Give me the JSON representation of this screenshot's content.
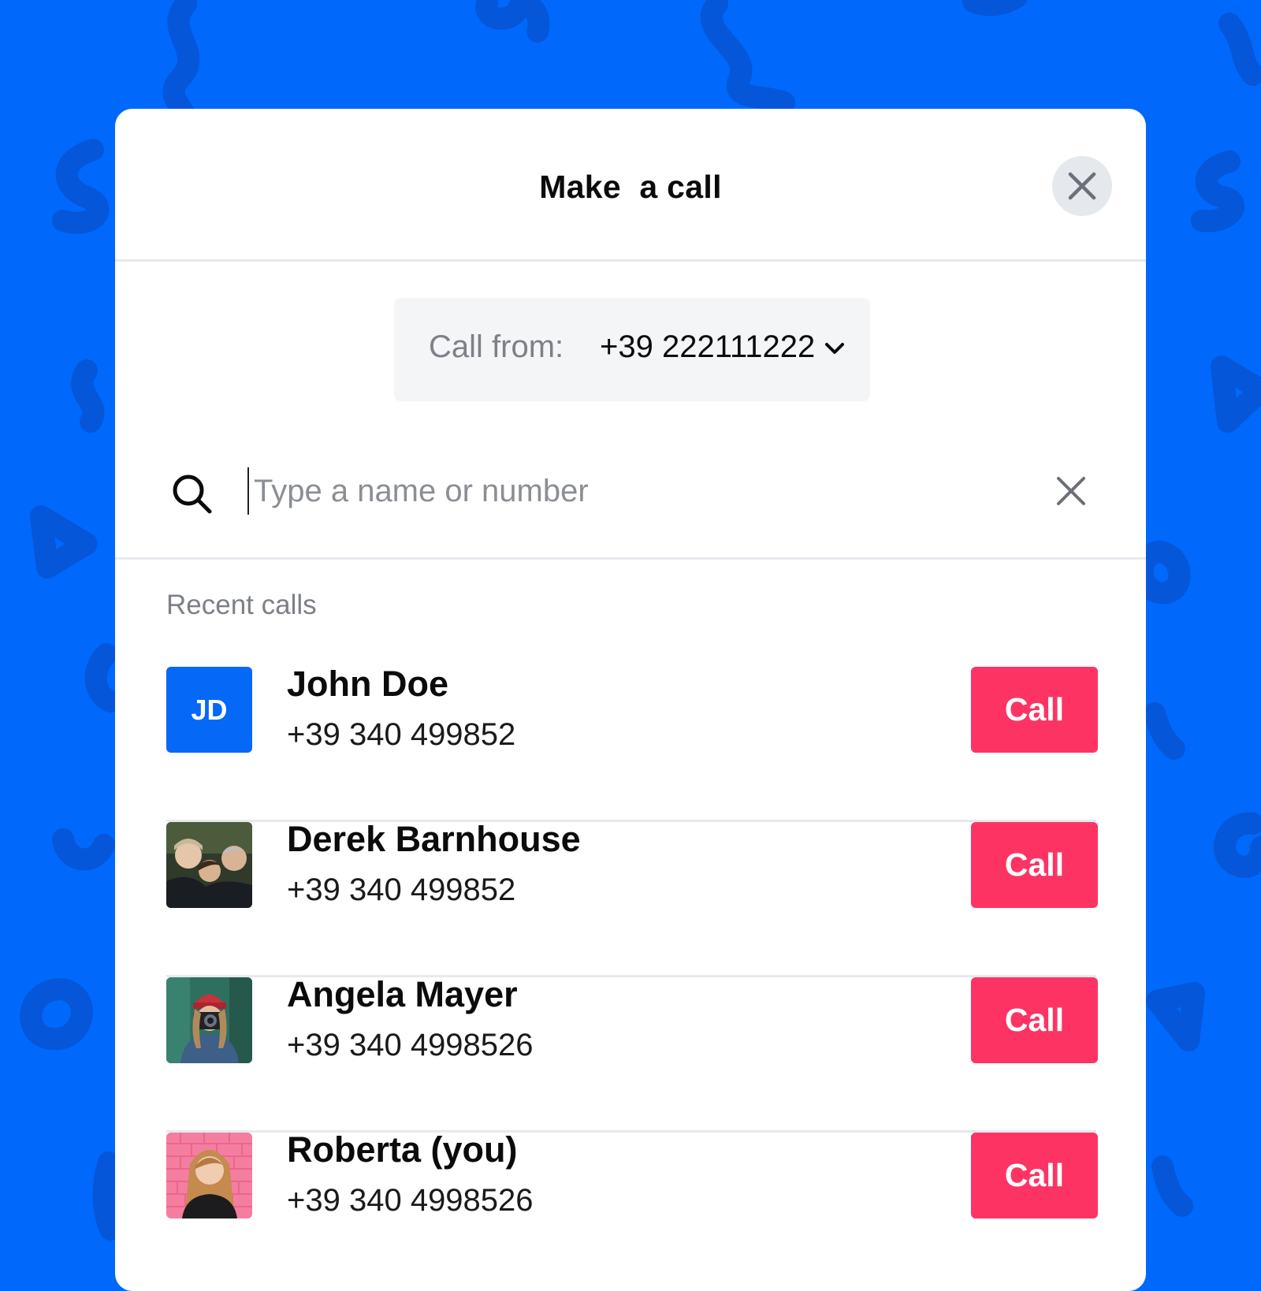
{
  "theme": {
    "background": "#0068FB",
    "doodle": "#0556D9",
    "accent_call": "#FD3463",
    "avatar_initials_bg": "#0668F7"
  },
  "modal": {
    "title": "Make  a call",
    "close_icon": "close-icon"
  },
  "call_from": {
    "label": "Call from:",
    "number": "+39 222111222",
    "chevron_icon": "chevron-down-icon"
  },
  "search": {
    "value": "",
    "placeholder": "Type a name or number",
    "search_icon": "search-icon",
    "clear_icon": "close-icon"
  },
  "recent": {
    "title": "Recent calls",
    "call_label": "Call",
    "items": [
      {
        "name": "John Doe",
        "phone": "+39 340 499852",
        "initials": "JD",
        "avatar": "initials"
      },
      {
        "name": "Derek Barnhouse",
        "phone": "+39 340 499852",
        "initials": "",
        "avatar": "photo-group"
      },
      {
        "name": "Angela Mayer",
        "phone": "+39 340 4998526",
        "initials": "",
        "avatar": "photo-camera"
      },
      {
        "name": "Roberta (you)",
        "phone": "+39 340 4998526",
        "initials": "",
        "avatar": "photo-portrait"
      }
    ]
  }
}
